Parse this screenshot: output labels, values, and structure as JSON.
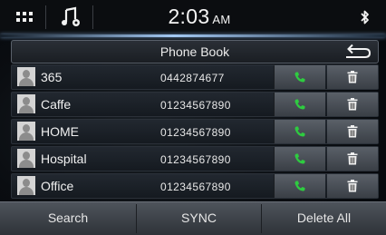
{
  "status": {
    "time": "2:03",
    "ampm": "AM",
    "icons": [
      "menu-grid-icon",
      "music-settings-icon",
      "bluetooth-icon"
    ]
  },
  "title": "Phone Book",
  "back_icon": "back-arrow-icon",
  "contacts": [
    {
      "name": "365",
      "number": "0442874677"
    },
    {
      "name": "Caffe",
      "number": "01234567890"
    },
    {
      "name": "HOME",
      "number": "01234567890"
    },
    {
      "name": "Hospital",
      "number": "01234567890"
    },
    {
      "name": "Office",
      "number": "01234567890"
    }
  ],
  "row_icons": {
    "call": "phone-call-icon",
    "delete": "trash-icon",
    "avatar": "contact-avatar-icon"
  },
  "colors": {
    "call_green": "#2ecc40",
    "accent_glow": "#a8d2ff"
  },
  "bottom": {
    "search_label": "Search",
    "sync_label": "SYNC",
    "delete_all_label": "Delete All"
  }
}
